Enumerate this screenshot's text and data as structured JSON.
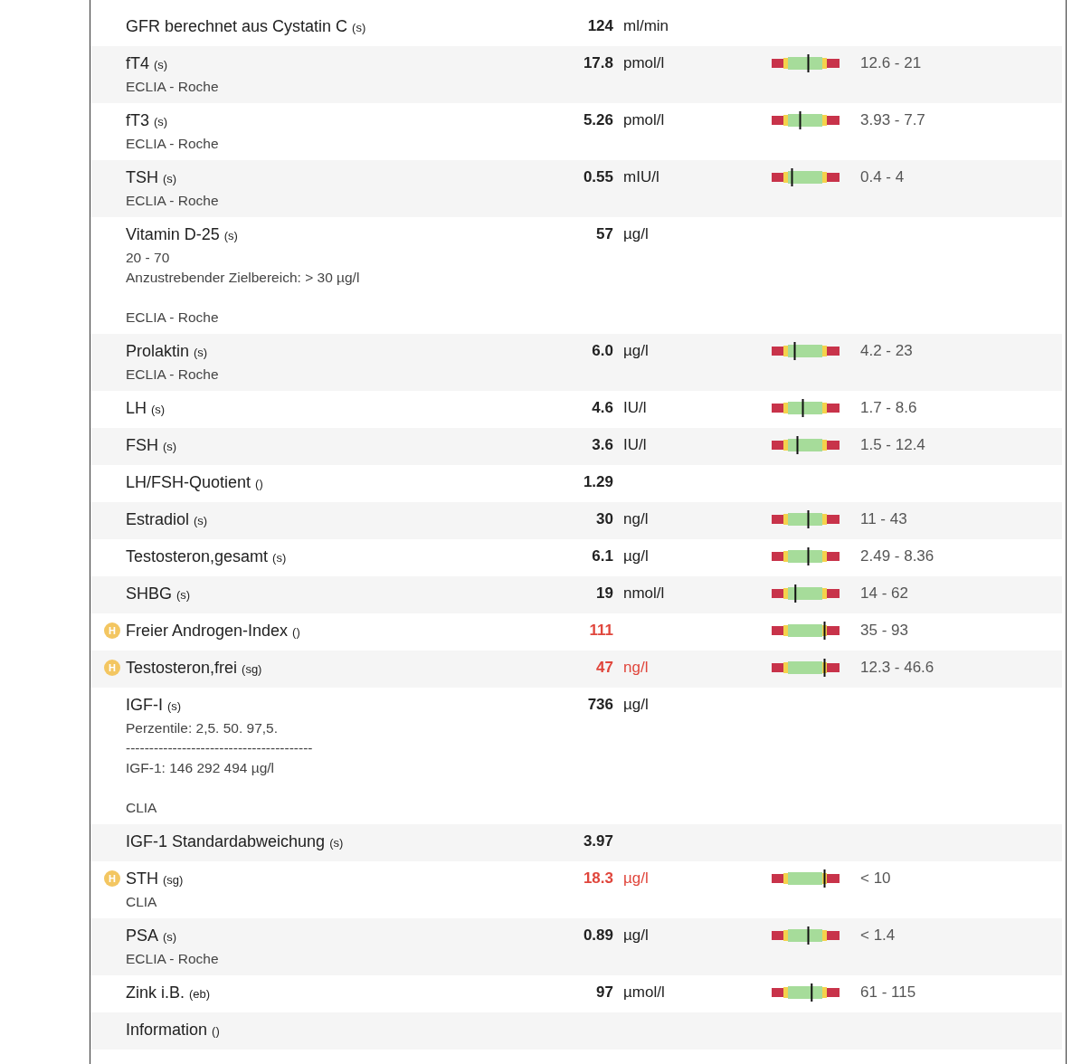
{
  "rows": [
    {
      "name": "GFR berechnet aus Cystatin C",
      "source": "(s)",
      "value": "124",
      "unit": "ml/min"
    },
    {
      "name": "fT4",
      "source": "(s)",
      "value": "17.8",
      "unit": "pmol/l",
      "level": 0.54,
      "range": "12.6 - 21",
      "method": "ECLIA - Roche"
    },
    {
      "name": "fT3",
      "source": "(s)",
      "value": "5.26",
      "unit": "pmol/l",
      "level": 0.42,
      "range": "3.93 - 7.7",
      "method": "ECLIA - Roche"
    },
    {
      "name": "TSH",
      "source": "(s)",
      "value": "0.55",
      "unit": "mIU/l",
      "level": 0.3,
      "range": "0.4 - 4",
      "method": "ECLIA - Roche"
    },
    {
      "name": "Vitamin D-25",
      "source": "(s)",
      "value": "57",
      "unit": "µg/l",
      "notes": [
        "20 - 70",
        "Anzustrebender Zielbereich: > 30 µg/l"
      ],
      "method": "ECLIA - Roche"
    },
    {
      "name": "Prolaktin",
      "source": "(s)",
      "value": "6.0",
      "unit": "µg/l",
      "level": 0.34,
      "range": "4.2 - 23",
      "method": "ECLIA - Roche"
    },
    {
      "name": "LH",
      "source": "(s)",
      "value": "4.6",
      "unit": "IU/l",
      "level": 0.46,
      "range": "1.7 - 8.6"
    },
    {
      "name": "FSH",
      "source": "(s)",
      "value": "3.6",
      "unit": "IU/l",
      "level": 0.38,
      "range": "1.5 - 12.4"
    },
    {
      "name": "LH/FSH-Quotient",
      "source": "()",
      "value": "1.29"
    },
    {
      "name": "Estradiol",
      "source": "(s)",
      "value": "30",
      "unit": "ng/l",
      "level": 0.54,
      "range": "11 - 43"
    },
    {
      "name": "Testosteron,gesamt",
      "source": "(s)",
      "value": "6.1",
      "unit": "µg/l",
      "level": 0.54,
      "range": "2.49 - 8.36"
    },
    {
      "name": "SHBG",
      "source": "(s)",
      "value": "19",
      "unit": "nmol/l",
      "level": 0.35,
      "range": "14 - 62"
    },
    {
      "flag": "H",
      "name": "Freier Androgen-Index",
      "source": "()",
      "value": "111",
      "level": 0.78,
      "range": "35 - 93"
    },
    {
      "flag": "H",
      "name": "Testosteron,frei",
      "source": "(sg)",
      "value": "47",
      "unit": "ng/l",
      "level": 0.78,
      "range": "12.3 - 46.6"
    },
    {
      "name": "IGF-I",
      "source": "(s)",
      "value": "736",
      "unit": "µg/l",
      "notes": [
        "Perzentile: 2,5. 50. 97,5.",
        "----------------------------------------",
        "IGF-1: 146 292 494 µg/l"
      ],
      "method": "CLIA"
    },
    {
      "name": "IGF-1 Standardabweichung",
      "source": "(s)",
      "value": "3.97"
    },
    {
      "flag": "H",
      "name": "STH",
      "source": "(sg)",
      "value": "18.3",
      "unit": "µg/l",
      "level": 0.78,
      "range": "< 10",
      "method": "CLIA"
    },
    {
      "name": "PSA",
      "source": "(s)",
      "value": "0.89",
      "unit": "µg/l",
      "level": 0.54,
      "range": "< 1.4",
      "method": "ECLIA - Roche"
    },
    {
      "name": "Zink i.B.",
      "source": "(eb)",
      "value": "97",
      "unit": "µmol/l",
      "level": 0.59,
      "range": "61 - 115"
    },
    {
      "name": "Information",
      "source": "()"
    }
  ]
}
